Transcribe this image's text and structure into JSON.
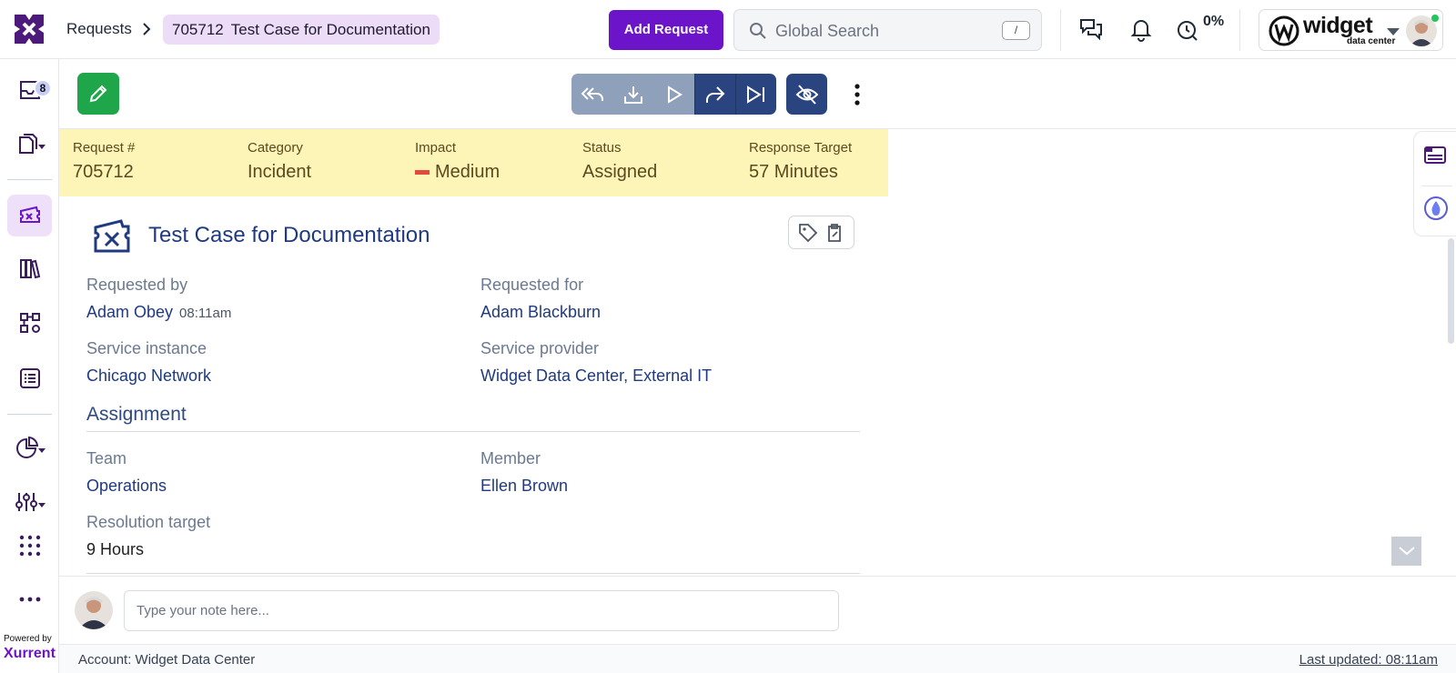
{
  "header": {
    "breadcrumb_root": "Requests",
    "request_id": "705712",
    "request_title": "Test Case for Documentation",
    "add_button": "Add Request",
    "search_placeholder": "Global Search",
    "search_shortcut": "/",
    "progress_percent": "0%",
    "account_logo": {
      "name": "widget",
      "subtitle": "data center"
    }
  },
  "sidebar": {
    "items": [
      {
        "icon": "inbox-icon",
        "badge": "8"
      },
      {
        "icon": "copies-icon"
      },
      {
        "icon": "ticket-icon",
        "active": true
      },
      {
        "icon": "library-icon"
      },
      {
        "icon": "workflow-icon"
      },
      {
        "icon": "list-icon"
      },
      {
        "icon": "analytics-icon"
      },
      {
        "icon": "settings-sliders-icon"
      },
      {
        "icon": "apps-grid-icon"
      },
      {
        "icon": "more-icon"
      }
    ],
    "powered_by": "Powered by",
    "brand": "Xurrent"
  },
  "toolbar": {
    "actions": [
      "reply-all-icon",
      "download-icon",
      "play-icon",
      "forward-icon",
      "skip-next-icon"
    ],
    "hide_icon": "eye-off-icon"
  },
  "summary": {
    "request_label": "Request #",
    "request_value": "705712",
    "category_label": "Category",
    "category_value": "Incident",
    "impact_label": "Impact",
    "impact_value": "Medium",
    "status_label": "Status",
    "status_value": "Assigned",
    "response_label": "Response Target",
    "response_value": "57 Minutes"
  },
  "details": {
    "title": "Test Case for Documentation",
    "requested_by_label": "Requested by",
    "requested_by": "Adam Obey",
    "requested_time": "08:11am",
    "requested_for_label": "Requested for",
    "requested_for": "Adam Blackburn",
    "service_instance_label": "Service instance",
    "service_instance": "Chicago Network",
    "service_provider_label": "Service provider",
    "service_provider": "Widget Data Center, External IT"
  },
  "assignment": {
    "title": "Assignment",
    "team_label": "Team",
    "team": "Operations",
    "member_label": "Member",
    "member": "Ellen Brown",
    "resolution_label": "Resolution target",
    "resolution": "9 Hours"
  },
  "note": {
    "placeholder": "Type your note here..."
  },
  "footer": {
    "account": "Account: Widget Data Center",
    "last_updated": "Last updated: 08:11am"
  },
  "colors": {
    "brand_purple": "#6b14c9",
    "navy": "#2a4480",
    "summary_bg": "#fdf4b8",
    "edit_green": "#1fa64a"
  }
}
